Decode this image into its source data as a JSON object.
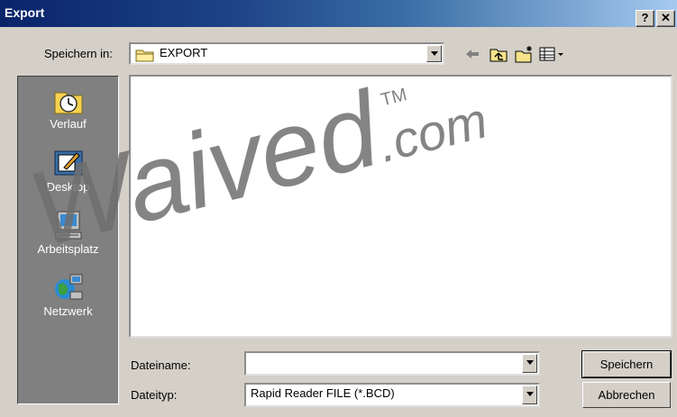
{
  "window": {
    "title": "Export",
    "help_label": "?",
    "close_label": "✕"
  },
  "save_in": {
    "label": "Speichern in:",
    "value": "EXPORT"
  },
  "toolbar": {
    "back_icon": "back-arrow-icon",
    "up_icon": "up-folder-icon",
    "new_folder_icon": "new-folder-icon",
    "view_icon": "view-menu-icon"
  },
  "places": [
    {
      "label": "Verlauf",
      "icon": "history-icon"
    },
    {
      "label": "Desktop",
      "icon": "desktop-icon"
    },
    {
      "label": "Arbeitsplatz",
      "icon": "my-computer-icon"
    },
    {
      "label": "Netzwerk",
      "icon": "network-icon"
    }
  ],
  "filename": {
    "label": "Dateiname:",
    "value": ""
  },
  "filetype": {
    "label": "Dateityp:",
    "value": "Rapid Reader FILE (*.BCD)"
  },
  "buttons": {
    "save": "Speichern",
    "cancel": "Abbrechen"
  },
  "watermark": {
    "main": "Waived",
    "suffix": ".com",
    "tm": "TM"
  }
}
